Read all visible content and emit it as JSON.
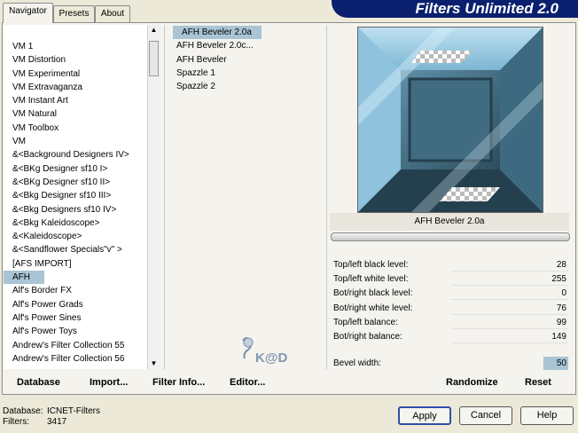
{
  "tabs": [
    {
      "label": "Navigator"
    },
    {
      "label": "Presets"
    },
    {
      "label": "About"
    }
  ],
  "banner": "Filters Unlimited 2.0",
  "categories": [
    "VM 1",
    "VM Distortion",
    "VM Experimental",
    "VM Extravaganza",
    "VM Instant Art",
    "VM Natural",
    "VM Toolbox",
    "VM",
    "&<Background Designers IV>",
    "&<BKg Designer sf10 I>",
    "&<BKg Designer sf10 II>",
    "&<Bkg Designer sf10 III>",
    "&<Bkg Designers sf10 IV>",
    "&<Bkg Kaleidoscope>",
    "&<Kaleidoscope>",
    "&<Sandflower Specials\"v\" >",
    "[AFS IMPORT]",
    "AFH",
    "Alf's Border FX",
    "Alf's Power Grads",
    "Alf's Power Sines",
    "Alf's Power Toys",
    "Andrew's Filter Collection 55",
    "Andrew's Filter Collection 56"
  ],
  "selected_category": "AFH",
  "filters": [
    "AFH Beveler 2.0a",
    "AFH Beveler 2.0c...",
    "AFH Beveler",
    "Spazzle 1",
    "Spazzle 2"
  ],
  "selected_filter": "AFH Beveler 2.0a",
  "preview_label": "AFH Beveler 2.0a",
  "params": [
    {
      "label": "Top/left black level:",
      "value": "28"
    },
    {
      "label": "Top/left white level:",
      "value": "255"
    },
    {
      "label": "Bot/right black level:",
      "value": "0"
    },
    {
      "label": "Bot/right white level:",
      "value": "76"
    },
    {
      "label": "Top/left balance:",
      "value": "99"
    },
    {
      "label": "Bot/right balance:",
      "value": "149"
    }
  ],
  "bevel": {
    "label": "Bevel width:",
    "value": "50"
  },
  "bottom_buttons": {
    "database": "Database",
    "import": "Import...",
    "filter_info": "Filter Info...",
    "editor": "Editor...",
    "randomize": "Randomize",
    "reset": "Reset"
  },
  "status": {
    "database_label": "Database:",
    "database_value": "ICNET-Filters",
    "filters_label": "Filters:",
    "filters_value": "3417"
  },
  "dialog_buttons": {
    "apply": "Apply",
    "cancel": "Cancel",
    "help": "Help"
  },
  "watermark": "K@D",
  "colors": {
    "banner": "#0a1f6e",
    "selection": "#a9c4d4",
    "preview": "#6fa9c6"
  }
}
